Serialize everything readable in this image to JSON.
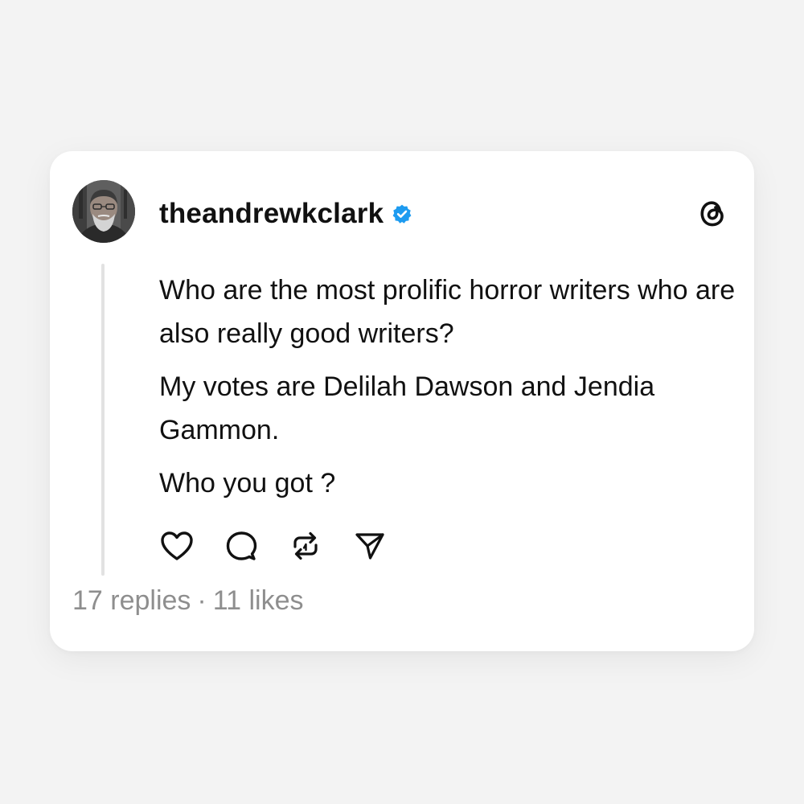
{
  "post": {
    "username": "theandrewkclark",
    "paragraphs": [
      "Who are the most prolific horror writers who are also really good writers?",
      "My votes are Delilah Dawson and Jendia Gammon.",
      "Who you got ?"
    ],
    "replies_text": "17 replies",
    "separator": "·",
    "likes_text": "11 likes",
    "icons": {
      "avatar": "profile-photo",
      "verified": "verified-badge-icon",
      "logo": "threads-logo-icon",
      "like": "heart-icon",
      "reply": "comment-bubble-icon",
      "repost": "repost-icon",
      "share": "send-icon"
    }
  },
  "colors": {
    "background": "#f3f3f3",
    "card": "#ffffff",
    "text": "#111111",
    "muted": "#8e8e8e",
    "verified": "#1d9bf0",
    "thread_line": "#e2e2e2"
  }
}
